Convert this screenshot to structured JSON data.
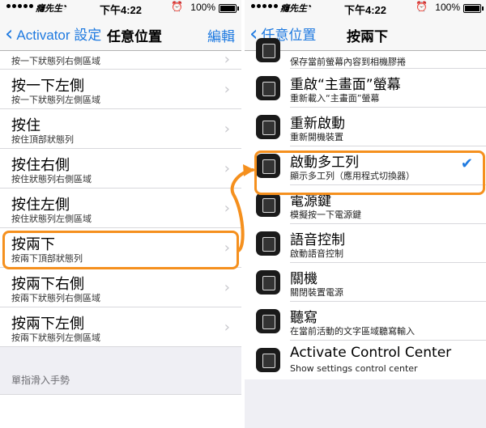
{
  "status": {
    "carrier": "癮先生",
    "time": "下午4:22",
    "battery": "100%"
  },
  "left": {
    "nav": {
      "back_label": "Activator 設定",
      "title": "任意位置",
      "edit_label": "編輯"
    },
    "items": [
      {
        "title": "",
        "subtitle": "按一下狀態列右側區域"
      },
      {
        "title": "按一下左側",
        "subtitle": "按一下狀態列左側區域"
      },
      {
        "title": "按住",
        "subtitle": "按住頂部狀態列"
      },
      {
        "title": "按住右側",
        "subtitle": "按住狀態列右側區域"
      },
      {
        "title": "按住左側",
        "subtitle": "按住狀態列左側區域"
      },
      {
        "title": "按兩下",
        "subtitle": "按兩下頂部狀態列"
      },
      {
        "title": "按兩下右側",
        "subtitle": "按兩下狀態列右側區域"
      },
      {
        "title": "按兩下左側",
        "subtitle": "按兩下狀態列左側區域"
      }
    ],
    "section_header": "單指滑入手勢"
  },
  "right": {
    "nav": {
      "back_label": "任意位置",
      "title": "按兩下"
    },
    "items": [
      {
        "title": "",
        "subtitle": "保存當前螢幕內容到相機膠捲",
        "icon": "screen-icon"
      },
      {
        "title": "重啟“主畫面”螢幕",
        "subtitle": "重新載入“主畫面”螢幕",
        "icon": "screen-icon"
      },
      {
        "title": "重新啟動",
        "subtitle": "重新開機裝置",
        "icon": "screen-icon"
      },
      {
        "title": "啟動多工列",
        "subtitle": "顯示多工列（應用程式切換器）",
        "icon": "screen-icon",
        "selected": true
      },
      {
        "title": "電源鍵",
        "subtitle": "模擬按一下電源鍵",
        "icon": "screen-icon"
      },
      {
        "title": "語音控制",
        "subtitle": "啟動語音控制",
        "icon": "screen-icon"
      },
      {
        "title": "關機",
        "subtitle": "關閉裝置電源",
        "icon": "screen-icon"
      },
      {
        "title": "聽寫",
        "subtitle": "在當前活動的文字區域聽寫輸入",
        "icon": "screen-icon"
      },
      {
        "title": "Activate Control Center",
        "subtitle": "Show settings control center",
        "icon": "screen-icon"
      }
    ]
  },
  "colors": {
    "accent": "#1f7ae0",
    "highlight": "#f5901e"
  }
}
